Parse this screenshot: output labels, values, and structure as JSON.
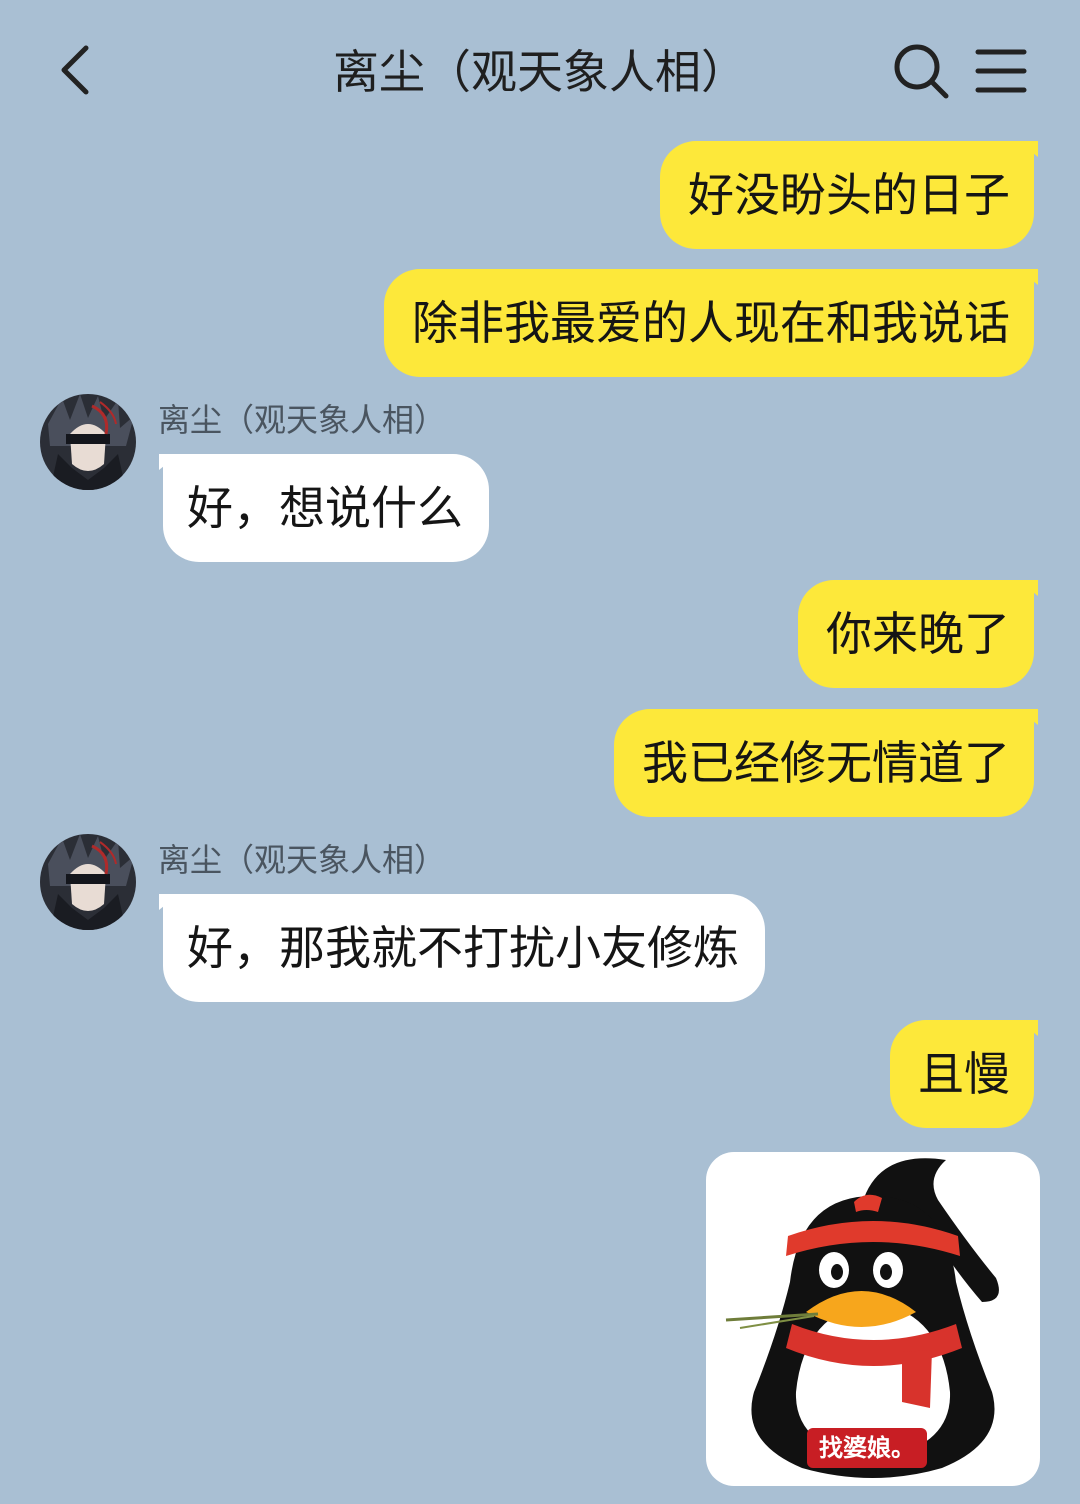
{
  "header": {
    "title": "离尘（观天象人相）",
    "back_icon": "chevron-left-icon",
    "search_icon": "search-icon",
    "menu_icon": "hamburger-menu-icon"
  },
  "messages": [
    {
      "direction": "out",
      "text": "好没盼头的日子"
    },
    {
      "direction": "out",
      "text": "除非我最爱的人现在和我说话"
    },
    {
      "direction": "in",
      "sender": "离尘（观天象人相）",
      "text": "好，想说什么"
    },
    {
      "direction": "out",
      "text": "你来晚了"
    },
    {
      "direction": "out",
      "text": "我已经修无情道了"
    },
    {
      "direction": "in",
      "sender": "离尘（观天象人相）",
      "text": "好，那我就不打扰小友修炼"
    },
    {
      "direction": "out",
      "text": "且慢"
    },
    {
      "direction": "out",
      "type": "sticker",
      "caption": "找婆娘。"
    }
  ],
  "colors": {
    "background": "#a9bfd3",
    "outgoing_bubble": "#fde83a",
    "incoming_bubble": "#ffffff",
    "sticker_caption_bg": "#c81e24"
  }
}
